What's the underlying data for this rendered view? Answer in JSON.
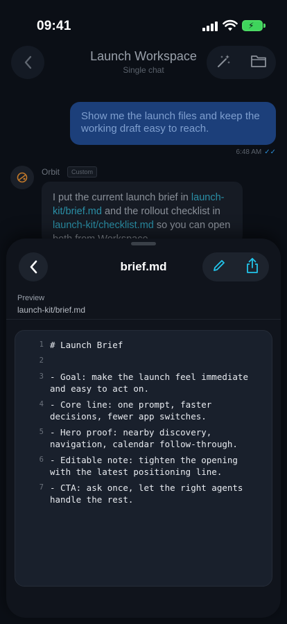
{
  "status_bar": {
    "time": "09:41"
  },
  "header": {
    "title": "Launch Workspace",
    "subtitle": "Single chat",
    "actions": [
      "magic-wand-icon",
      "folder-icon"
    ]
  },
  "chat": {
    "user_message": "Show me the launch files and keep the working draft easy to reach.",
    "user_time": "6:48 AM",
    "bot": {
      "name": "Orbit",
      "tag": "Custom",
      "text_1": "I put the current launch brief in ",
      "link_1": "launch-kit/brief.md",
      "text_2": " and the rollout checklist in ",
      "link_2": "launch-kit/checklist.md",
      "text_3": " so you can open both from Workspace."
    }
  },
  "sheet": {
    "title": "brief.md",
    "preview_label": "Preview",
    "preview_path": "launch-kit/brief.md",
    "lines": [
      {
        "num": "1",
        "text": "# Launch Brief"
      },
      {
        "num": "2",
        "text": ""
      },
      {
        "num": "3",
        "text": "- Goal: make the launch feel immediate\nand easy to act on."
      },
      {
        "num": "4",
        "text": "- Core line: one prompt, faster\ndecisions, fewer app switches."
      },
      {
        "num": "5",
        "text": "- Hero proof: nearby discovery,\nnavigation, calendar follow-through."
      },
      {
        "num": "6",
        "text": "- Editable note: tighten the opening\nwith the latest positioning line."
      },
      {
        "num": "7",
        "text": "- CTA: ask once, let the right agents\nhandle the rest."
      }
    ]
  },
  "colors": {
    "background": "#0b0f16",
    "user_bubble": "#1c3f7a",
    "accent": "#22c4ea",
    "link": "#2a8fa6"
  }
}
